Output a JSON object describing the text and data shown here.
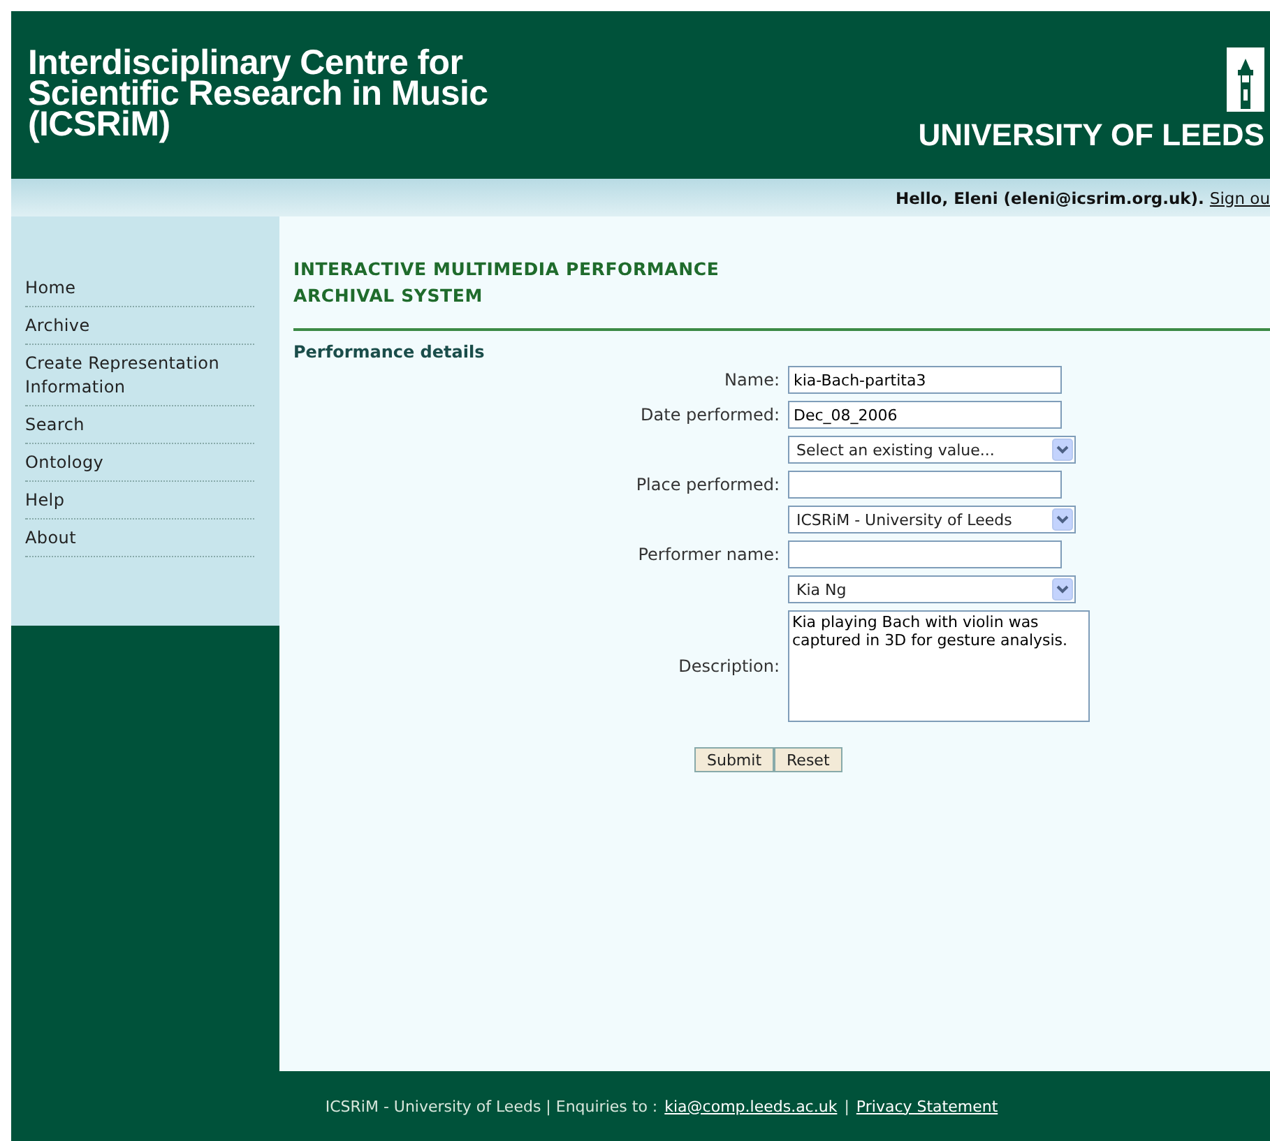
{
  "header": {
    "title_lines": [
      "Interdisciplinary Centre for",
      "Scientific Research in Music",
      "(ICSRiM)"
    ],
    "university": "UNIVERSITY OF LEEDS"
  },
  "user_bar": {
    "greeting": "Hello, Eleni (eleni@icsrim.org.uk).",
    "sign_out": "Sign ou"
  },
  "sidebar": {
    "items": [
      {
        "label": "Home"
      },
      {
        "label": "Archive"
      },
      {
        "label": "Create Representation Information"
      },
      {
        "label": "Search"
      },
      {
        "label": "Ontology"
      },
      {
        "label": "Help"
      },
      {
        "label": "About"
      }
    ]
  },
  "main": {
    "title_lines": [
      "INTERACTIVE MULTIMEDIA PERFORMANCE",
      "ARCHIVAL SYSTEM"
    ],
    "section": "Performance details",
    "fields": [
      {
        "kind": "text",
        "label": "Name:",
        "value": "kia-Bach-partita3"
      },
      {
        "kind": "text",
        "label": "Date performed:",
        "value": "Dec_08_2006"
      },
      {
        "kind": "select",
        "value": "Select an existing value..."
      },
      {
        "kind": "text",
        "label": "Place performed:"
      },
      {
        "kind": "select",
        "value": "ICSRiM - University of Leeds"
      },
      {
        "kind": "text",
        "label": "Performer name:"
      },
      {
        "kind": "select",
        "value": "Kia Ng"
      },
      {
        "kind": "textarea",
        "label": "Description:",
        "value": "Kia playing Bach with violin was captured in 3D for gesture analysis."
      }
    ],
    "buttons": [
      "Submit",
      "Reset"
    ]
  },
  "footer": {
    "text": "ICSRiM - University of Leeds | Enquiries to :",
    "email": "kia@comp.leeds.ac.uk",
    "separator": "|",
    "privacy": "Privacy Statement"
  }
}
